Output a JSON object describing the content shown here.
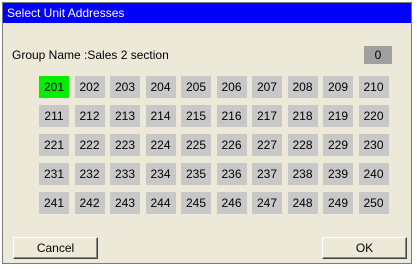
{
  "window": {
    "title": "Select Unit Addresses"
  },
  "group": {
    "label": "Group Name :Sales 2 section",
    "count": "0"
  },
  "colors": {
    "selected": "#00ee00",
    "unselected": "#c8c8c8",
    "titlebar": "#0000ff"
  },
  "units": [
    [
      "201",
      "202",
      "203",
      "204",
      "205",
      "206",
      "207",
      "208",
      "209",
      "210"
    ],
    [
      "211",
      "212",
      "213",
      "214",
      "215",
      "216",
      "217",
      "218",
      "219",
      "220"
    ],
    [
      "221",
      "222",
      "223",
      "224",
      "225",
      "226",
      "227",
      "228",
      "229",
      "230"
    ],
    [
      "231",
      "232",
      "233",
      "234",
      "235",
      "236",
      "237",
      "238",
      "239",
      "240"
    ],
    [
      "241",
      "242",
      "243",
      "244",
      "245",
      "246",
      "247",
      "248",
      "249",
      "250"
    ]
  ],
  "selected_units": [
    "201"
  ],
  "buttons": {
    "cancel": "Cancel",
    "ok": "OK"
  }
}
